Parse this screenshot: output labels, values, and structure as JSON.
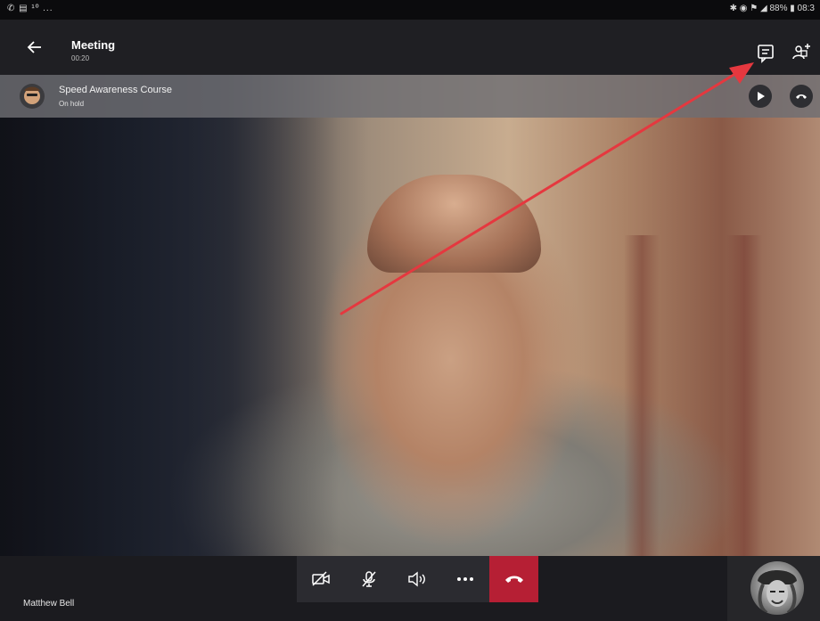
{
  "status_bar": {
    "left": "✆ ▤ ¹º ...",
    "right": "✱ ◉ ⚑ ◢ 88% ▮ 08:3"
  },
  "header": {
    "title": "Meeting",
    "timer": "00:20"
  },
  "hold_banner": {
    "name": "Speed Awareness Course",
    "status": "On hold"
  },
  "participant": {
    "name": "Matthew Bell"
  },
  "icons": {
    "back": "back-arrow-icon",
    "chat": "chat-icon",
    "people": "add-people-icon",
    "resume": "play-icon",
    "hold_hangup": "hang-up-icon",
    "camera": "camera-off-icon",
    "mic": "mic-off-icon",
    "speaker": "speaker-icon",
    "more": "more-icon",
    "end": "hang-up-icon"
  },
  "colors": {
    "end_call": "#b61f34",
    "annotation_arrow": "#e5383f"
  }
}
